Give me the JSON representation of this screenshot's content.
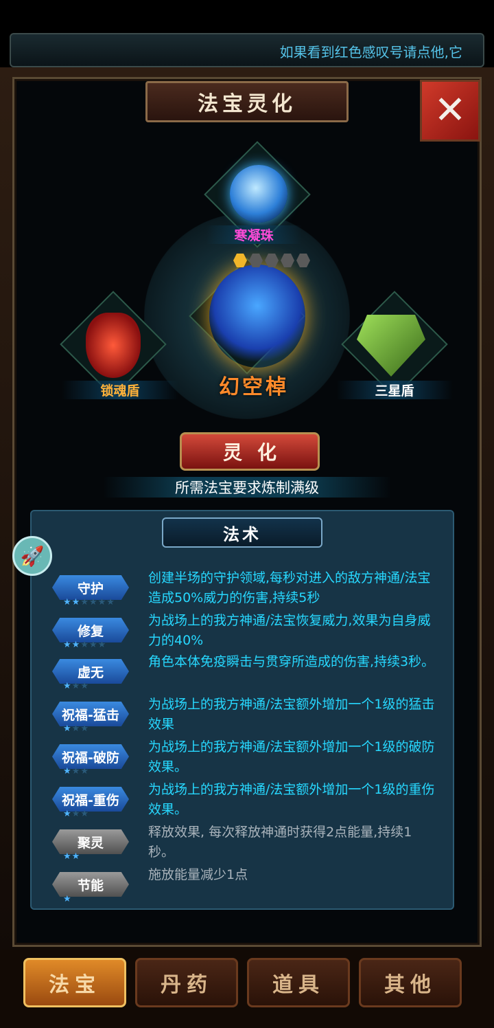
{
  "marquee": "如果看到红色感叹号请点他,它",
  "title": "法宝灵化",
  "close_icon": "close-x",
  "items": {
    "top": {
      "name": "寒凝珠"
    },
    "left": {
      "name": "锁魂盾"
    },
    "right": {
      "name": "三星盾"
    },
    "main": {
      "name": "幻空棹",
      "level_filled": 1,
      "level_max": 5
    }
  },
  "spirit_button": "灵化",
  "requirement": "所需法宝要求炼制满级",
  "skills_title": "法术",
  "skills": [
    {
      "name": "守护",
      "stars_filled": 2,
      "stars_total": 6,
      "active": true,
      "desc": "创建半场的守护领域,每秒对进入的敌方神通/法宝造成50%威力的伤害,持续5秒"
    },
    {
      "name": "修复",
      "stars_filled": 2,
      "stars_total": 5,
      "active": true,
      "desc": "为战场上的我方神通/法宝恢复威力,效果为自身威力的40%"
    },
    {
      "name": "虚无",
      "stars_filled": 1,
      "stars_total": 3,
      "active": true,
      "desc": "角色本体免疫瞬击与贯穿所造成的伤害,持续3秒。"
    },
    {
      "name": "祝福-猛击",
      "stars_filled": 1,
      "stars_total": 3,
      "active": true,
      "desc": "为战场上的我方神通/法宝额外增加一个1级的猛击效果"
    },
    {
      "name": "祝福-破防",
      "stars_filled": 1,
      "stars_total": 3,
      "active": true,
      "desc": "为战场上的我方神通/法宝额外增加一个1级的破防效果。"
    },
    {
      "name": "祝福-重伤",
      "stars_filled": 1,
      "stars_total": 3,
      "active": true,
      "desc": "为战场上的我方神通/法宝额外增加一个1级的重伤效果。"
    },
    {
      "name": "聚灵",
      "stars_filled": 2,
      "stars_total": 2,
      "active": false,
      "desc": "释放效果, 每次释放神通时获得2点能量,持续1秒。"
    },
    {
      "name": "节能",
      "stars_filled": 1,
      "stars_total": 1,
      "active": false,
      "desc": "施放能量减少1点"
    }
  ],
  "tabs": [
    {
      "label": "法宝",
      "active": true
    },
    {
      "label": "丹药",
      "active": false
    },
    {
      "label": "道具",
      "active": false
    },
    {
      "label": "其他",
      "active": false
    }
  ],
  "colors": {
    "accent": "#27d8ff",
    "gold": "#f2b62a",
    "red": "#d03a2a"
  }
}
